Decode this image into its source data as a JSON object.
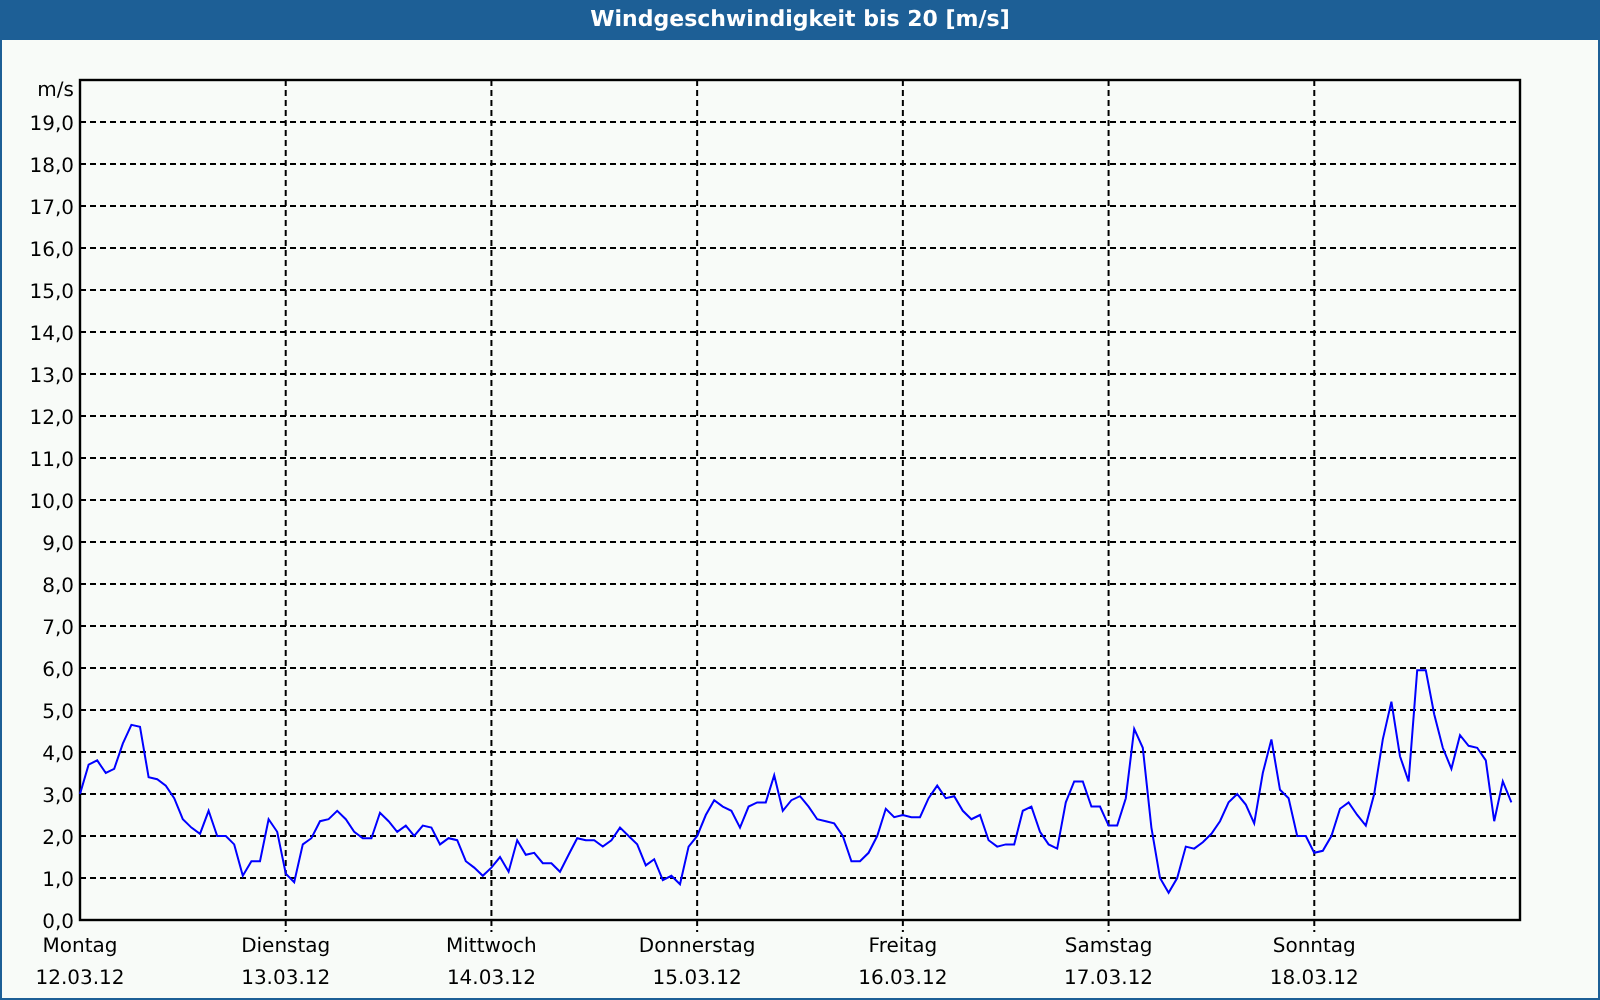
{
  "chart_data": {
    "type": "line",
    "title": "Windgeschwindigkeit bis 20 [m/s]",
    "ylabel": "m/s",
    "ylim": [
      0,
      20
    ],
    "grid": true,
    "categories": [
      "Montag",
      null,
      null,
      null,
      null,
      null,
      null,
      null,
      null,
      null,
      null,
      null,
      null,
      null,
      null,
      null,
      null,
      null,
      null,
      null,
      null,
      null,
      null,
      null,
      "Dienstag",
      null,
      null,
      null,
      null,
      null,
      null,
      null,
      null,
      null,
      null,
      null,
      null,
      null,
      null,
      null,
      null,
      null,
      null,
      null,
      null,
      null,
      null,
      null,
      "Mittwoch",
      null,
      null,
      null,
      null,
      null,
      null,
      null,
      null,
      null,
      null,
      null,
      null,
      null,
      null,
      null,
      null,
      null,
      null,
      null,
      null,
      null,
      null,
      null,
      "Donnerstag",
      null,
      null,
      null,
      null,
      null,
      null,
      null,
      null,
      null,
      null,
      null,
      null,
      null,
      null,
      null,
      null,
      null,
      null,
      null,
      null,
      null,
      null,
      null,
      "Freitag",
      null,
      null,
      null,
      null,
      null,
      null,
      null,
      null,
      null,
      null,
      null,
      null,
      null,
      null,
      null,
      null,
      null,
      null,
      null,
      null,
      null,
      null,
      null,
      "Samstag",
      null,
      null,
      null,
      null,
      null,
      null,
      null,
      null,
      null,
      null,
      null,
      null,
      null,
      null,
      null,
      null,
      null,
      null,
      null,
      null,
      null,
      null,
      null,
      "Sonntag",
      null,
      null,
      null,
      null,
      null,
      null,
      null,
      null,
      null,
      null,
      null,
      null,
      null,
      null,
      null,
      null,
      null,
      null,
      null,
      null,
      null,
      null,
      null
    ],
    "yticks": [
      {
        "value": 0,
        "label": "0,0"
      },
      {
        "value": 1,
        "label": "1,0"
      },
      {
        "value": 2,
        "label": "2,0"
      },
      {
        "value": 3,
        "label": "3,0"
      },
      {
        "value": 4,
        "label": "4,0"
      },
      {
        "value": 5,
        "label": "5,0"
      },
      {
        "value": 6,
        "label": "6,0"
      },
      {
        "value": 7,
        "label": "7,0"
      },
      {
        "value": 8,
        "label": "8,0"
      },
      {
        "value": 9,
        "label": "9,0"
      },
      {
        "value": 10,
        "label": "10,0"
      },
      {
        "value": 11,
        "label": "11,0"
      },
      {
        "value": 12,
        "label": "12,0"
      },
      {
        "value": 13,
        "label": "13,0"
      },
      {
        "value": 14,
        "label": "14,0"
      },
      {
        "value": 15,
        "label": "15,0"
      },
      {
        "value": 16,
        "label": "16,0"
      },
      {
        "value": 17,
        "label": "17,0"
      },
      {
        "value": 18,
        "label": "18,0"
      },
      {
        "value": 19,
        "label": "19,0"
      }
    ],
    "series": [
      {
        "color": "#0000ff",
        "values": [
          3.0,
          3.7,
          3.8,
          3.5,
          3.6,
          4.2,
          4.65,
          4.6,
          3.4,
          3.35,
          3.2,
          2.9,
          2.4,
          2.2,
          2.05,
          2.6,
          2.0,
          2.0,
          1.8,
          1.05,
          1.4,
          1.4,
          2.4,
          2.1,
          1.1,
          0.9,
          1.8,
          1.95,
          2.35,
          2.4,
          2.6,
          2.4,
          2.1,
          1.95,
          1.95,
          2.55,
          2.35,
          2.1,
          2.25,
          2.0,
          2.25,
          2.2,
          1.8,
          1.95,
          1.9,
          1.4,
          1.25,
          1.05,
          1.25,
          1.5,
          1.15,
          1.9,
          1.55,
          1.6,
          1.35,
          1.35,
          1.15,
          1.55,
          1.95,
          1.9,
          1.9,
          1.75,
          1.9,
          2.2,
          2.0,
          1.8,
          1.3,
          1.45,
          0.95,
          1.05,
          0.85,
          1.75,
          2.0,
          2.5,
          2.85,
          2.7,
          2.6,
          2.2,
          2.7,
          2.8,
          2.8,
          3.45,
          2.6,
          2.85,
          2.95,
          2.7,
          2.4,
          2.35,
          2.3,
          2.0,
          1.4,
          1.4,
          1.6,
          2.0,
          2.65,
          2.45,
          2.5,
          2.45,
          2.45,
          2.9,
          3.2,
          2.9,
          2.95,
          2.6,
          2.4,
          2.5,
          1.9,
          1.75,
          1.8,
          1.8,
          2.6,
          2.7,
          2.1,
          1.8,
          1.7,
          2.8,
          3.3,
          3.3,
          2.7,
          2.7,
          2.25,
          2.25,
          2.9,
          4.55,
          4.1,
          2.2,
          1.0,
          0.65,
          1.0,
          1.75,
          1.7,
          1.85,
          2.05,
          2.35,
          2.8,
          3.0,
          2.75,
          2.3,
          3.5,
          4.3,
          3.1,
          2.9,
          2.0,
          2.0,
          1.6,
          1.65,
          2.0,
          2.65,
          2.8,
          2.5,
          2.25,
          3.0,
          4.3,
          5.2,
          3.9,
          3.3,
          5.95,
          5.95,
          4.9,
          4.1,
          3.6,
          4.4,
          4.15,
          4.1,
          3.8,
          2.35,
          3.3,
          2.8
        ]
      }
    ]
  },
  "x_axis_dates": [
    "12.03.12",
    "13.03.12",
    "14.03.12",
    "15.03.12",
    "16.03.12",
    "17.03.12",
    "18.03.12"
  ]
}
